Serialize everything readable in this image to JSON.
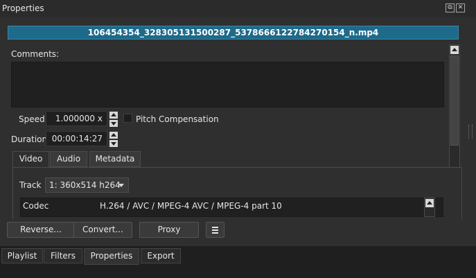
{
  "panel": {
    "title": "Properties",
    "float_icon": "float-icon",
    "close_icon": "close-icon"
  },
  "file": {
    "name": "106454354_328305131500287_5378666122784270154_n.mp4"
  },
  "comments": {
    "label": "Comments:",
    "value": ""
  },
  "speed": {
    "label": "Speed",
    "value": "1.000000 x",
    "pitch_label": "Pitch Compensation",
    "pitch_checked": false
  },
  "duration": {
    "label": "Duration",
    "value": "00:00:14:27"
  },
  "tabs": [
    {
      "label": "Video",
      "active": true
    },
    {
      "label": "Audio",
      "active": false
    },
    {
      "label": "Metadata",
      "active": false
    }
  ],
  "track": {
    "label": "Track",
    "value": "1: 360x514 h264"
  },
  "codec": {
    "key": "Codec",
    "value": "H.264 / AVC / MPEG-4 AVC / MPEG-4 part 10"
  },
  "actions": {
    "reverse": "Reverse...",
    "convert": "Convert...",
    "proxy": "Proxy",
    "menu_icon": "hamburger-menu-icon"
  },
  "bottom_tabs": [
    {
      "label": "Playlist",
      "active": false
    },
    {
      "label": "Filters",
      "active": false
    },
    {
      "label": "Properties",
      "active": true
    },
    {
      "label": "Export",
      "active": false
    }
  ],
  "colors": {
    "filename_bg": "#1e6a8a",
    "panel_bg": "#2f2f2f",
    "field_bg": "#202020"
  }
}
